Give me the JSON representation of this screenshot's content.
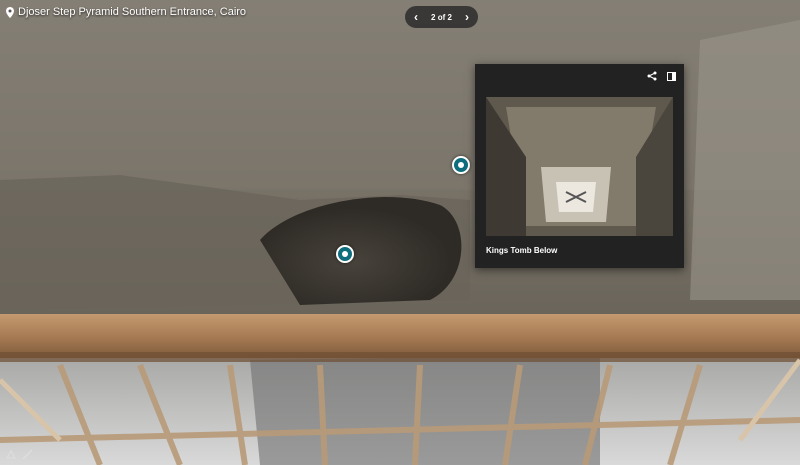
{
  "location": {
    "label": "Djoser Step Pyramid Southern Entrance, Cairo",
    "icon": "map-pin-icon"
  },
  "pager": {
    "text": "2 of 2",
    "prev_icon": "chevron-left-icon",
    "next_icon": "chevron-right-icon"
  },
  "card": {
    "title": "Kings Tomb Below",
    "share_icon": "share-icon",
    "expand_icon": "expand-icon"
  },
  "colors": {
    "hotspot": "#0e6e7e",
    "card_bg": "#222222"
  }
}
